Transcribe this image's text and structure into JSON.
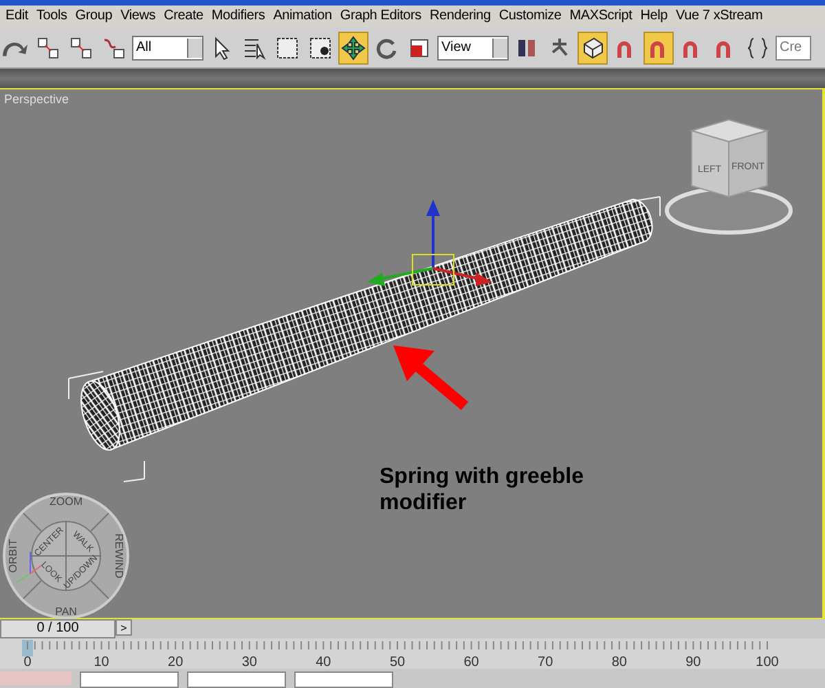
{
  "menu": [
    "Edit",
    "Tools",
    "Group",
    "Views",
    "Create",
    "Modifiers",
    "Animation",
    "Graph Editors",
    "Rendering",
    "Customize",
    "MAXScript",
    "Help",
    "Vue 7 xStream"
  ],
  "toolbar": {
    "tools": [
      {
        "kind": "redo",
        "selected": false
      },
      {
        "kind": "link",
        "selected": false
      },
      {
        "kind": "unlink",
        "selected": false
      },
      {
        "kind": "bind",
        "selected": false
      },
      {
        "kind": "filter",
        "value": "All"
      },
      {
        "kind": "pointer",
        "selected": false
      },
      {
        "kind": "list",
        "selected": false
      },
      {
        "kind": "region",
        "selected": false
      },
      {
        "kind": "crossing",
        "selected": false
      },
      {
        "kind": "move",
        "selected": true
      },
      {
        "kind": "rotate",
        "selected": false
      },
      {
        "kind": "scale",
        "selected": false
      },
      {
        "kind": "filter",
        "value": "View"
      },
      {
        "kind": "pivot",
        "selected": false
      },
      {
        "kind": "manipulate",
        "selected": false
      },
      {
        "kind": "keyboard",
        "selected": true
      },
      {
        "kind": "snap",
        "selected": false
      },
      {
        "kind": "anglesnap",
        "selected": true
      },
      {
        "kind": "percentsnap",
        "selected": false
      },
      {
        "kind": "spinnersnap",
        "selected": false
      },
      {
        "kind": "braces",
        "selected": false
      },
      {
        "kind": "field",
        "placeholder": "Cre"
      }
    ]
  },
  "viewport": {
    "label": "Perspective",
    "annotation": "Spring with greeble modifier",
    "viewcube": [
      "LEFT",
      "FRONT"
    ],
    "wheel": {
      "outer": [
        "ZOOM",
        "REWIND",
        "PAN",
        "ORBIT"
      ],
      "inner": [
        "CENTER",
        "WALK",
        "UP/DOWN",
        "LOOK"
      ]
    }
  },
  "time_slider": {
    "frame": "0 / 100",
    "level": 0,
    "next": ">"
  },
  "ruler": [
    "0",
    "10",
    "20",
    "30",
    "40",
    "50",
    "60",
    "70",
    "80",
    "90",
    "100"
  ]
}
